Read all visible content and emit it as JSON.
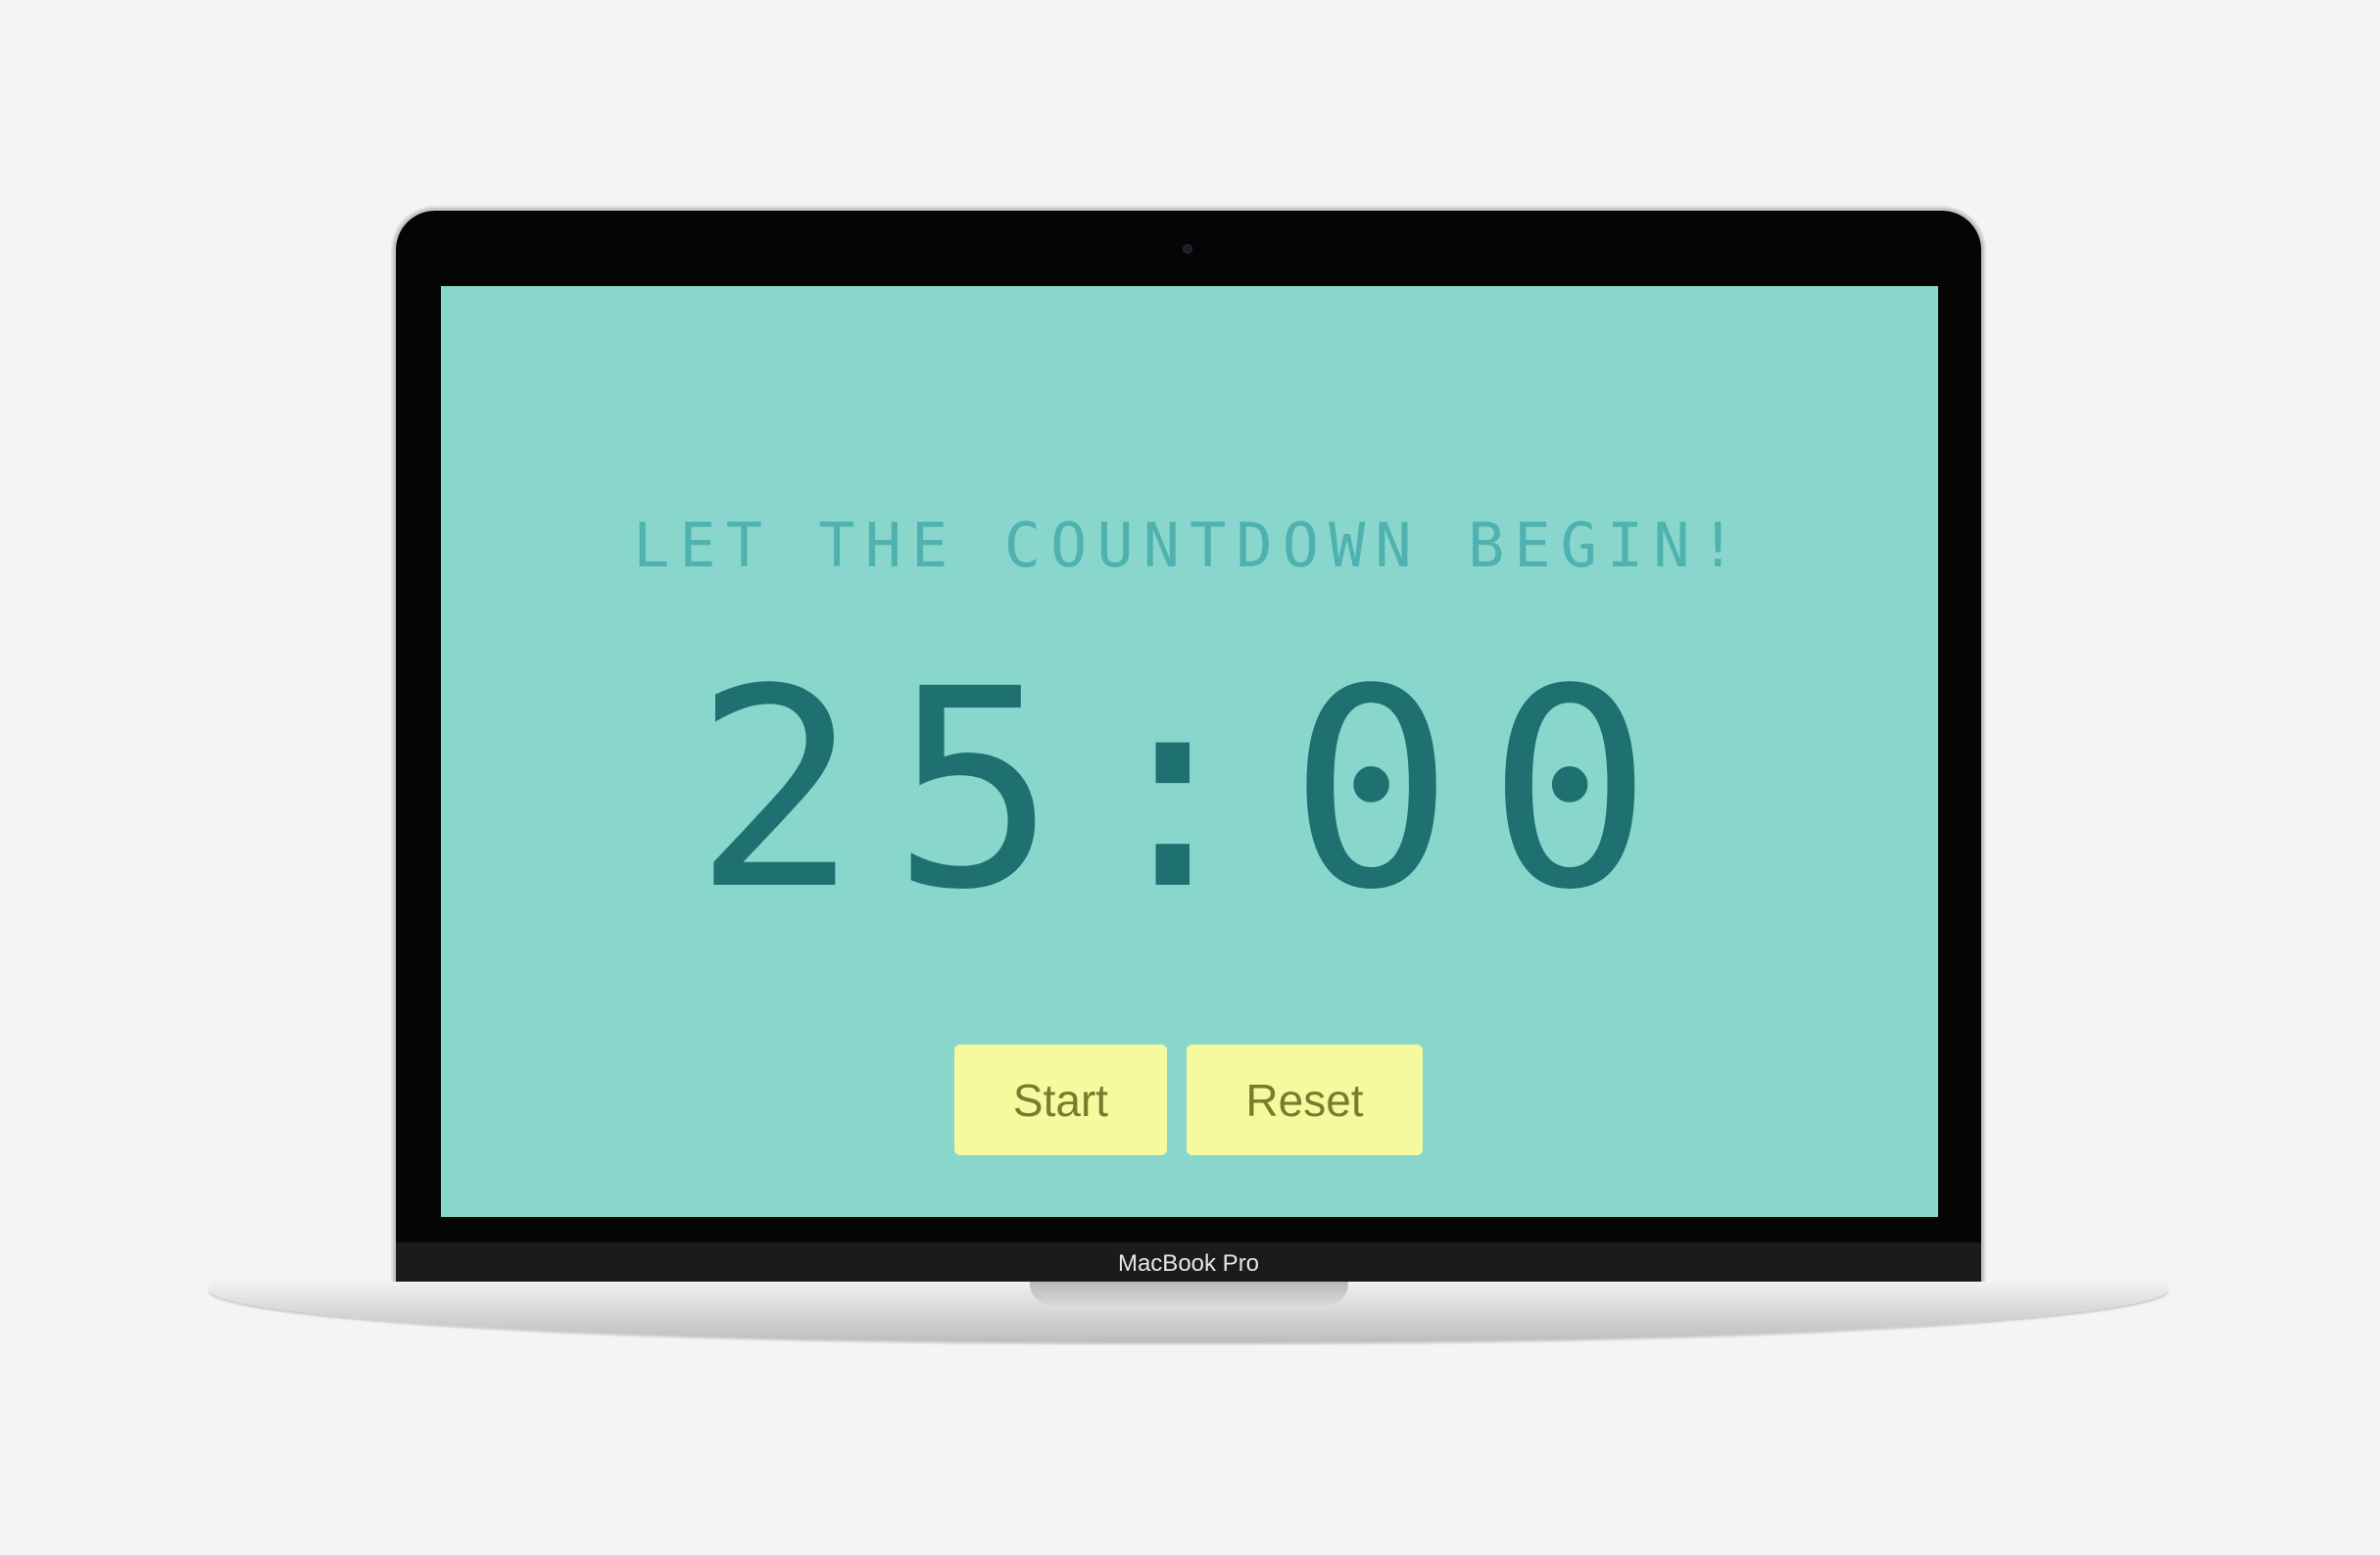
{
  "device": {
    "brand_label": "MacBook Pro"
  },
  "app": {
    "headline": "LET THE COUNTDOWN BEGIN!",
    "timer": "25:00",
    "buttons": {
      "start": "Start",
      "reset": "Reset"
    }
  },
  "colors": {
    "screen_background": "#89d7cc",
    "headline": "#4fb2b0",
    "timer": "#1f7171",
    "button_background": "#f6fa9f",
    "button_text": "#7d7a2e",
    "page_background": "#f4f4f4"
  }
}
